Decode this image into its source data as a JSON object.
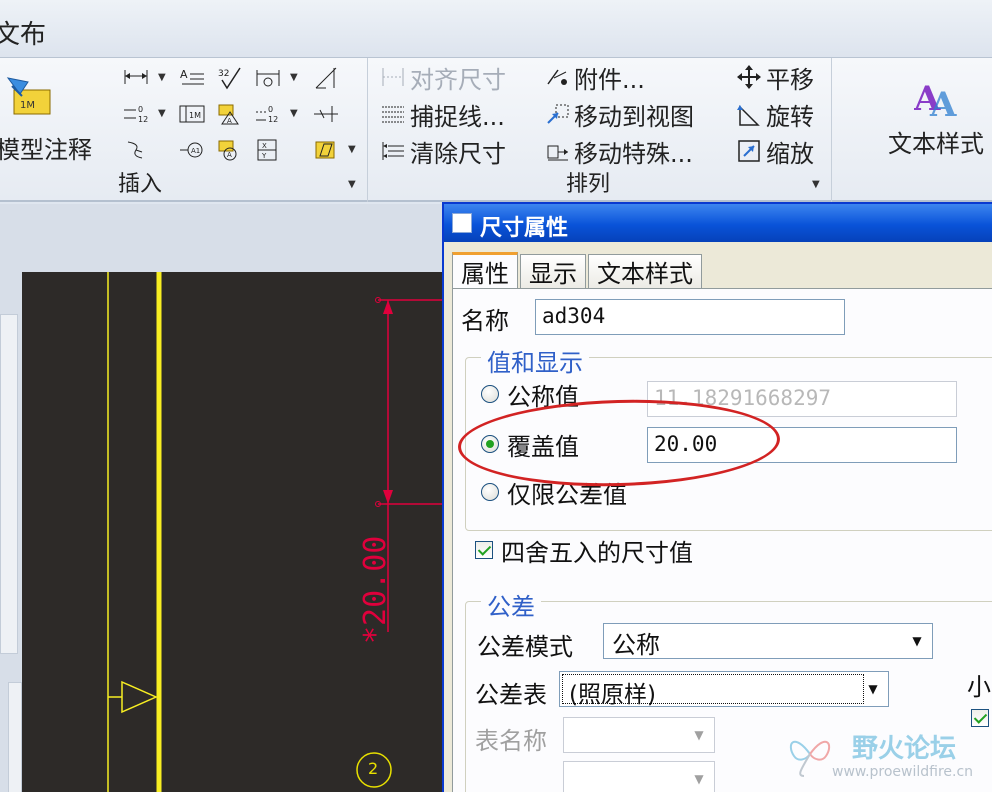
{
  "ribbon": {
    "tab_label": "文布",
    "insert_group": {
      "label": "插入",
      "big_button_label": "模型注释",
      "icons": [
        "linear-dimension-icon",
        "note-icon",
        "surface-finish-icon",
        "ordinate-dimension-icon",
        "reference-dimension-icon",
        "baseline-dimension-icon",
        "table-icon",
        "datum-feature-icon",
        "ordinate-baseline-icon",
        "jog-icon",
        "symbol-icon",
        "balloon-icon",
        "datum-target-icon",
        "geometric-tolerance-icon",
        "flatness-icon"
      ]
    },
    "arrange_group": {
      "label": "排列",
      "commands": [
        {
          "label": "对齐尺寸",
          "icon": "align-dimension-icon",
          "disabled": true
        },
        {
          "label": "附件...",
          "icon": "attachment-icon",
          "disabled": false
        },
        {
          "label": "平移",
          "icon": "move-icon",
          "disabled": false
        },
        {
          "label": "捕捉线...",
          "icon": "snap-line-icon",
          "disabled": false
        },
        {
          "label": "移动到视图",
          "icon": "move-to-view-icon",
          "disabled": false
        },
        {
          "label": "旋转",
          "icon": "rotate-icon",
          "disabled": false
        },
        {
          "label": "清除尺寸",
          "icon": "clean-dimension-icon",
          "disabled": false
        },
        {
          "label": "移动特殊...",
          "icon": "move-special-icon",
          "disabled": false
        },
        {
          "label": "缩放",
          "icon": "scale-icon",
          "disabled": false
        }
      ]
    },
    "text_style_group": {
      "label": "文本样式"
    }
  },
  "drawing": {
    "dimension_text": "*20.00",
    "balloon_number": "2",
    "colors": {
      "background": "#2d2a28",
      "geometry": "#f7ee22",
      "dimension": "#e0003c",
      "balloon": "#e8e000"
    }
  },
  "dialog": {
    "title": "尺寸属性",
    "tabs": [
      {
        "label": "属性",
        "active": true
      },
      {
        "label": "显示",
        "active": false
      },
      {
        "label": "文本样式",
        "active": false
      }
    ],
    "name_label": "名称",
    "name_value": "ad304",
    "value_display": {
      "legend": "值和显示",
      "nominal_label": "公称值",
      "nominal_value": "11.18291668297",
      "override_label": "覆盖值",
      "override_value": "20.00",
      "tolerance_only_label": "仅限公差值",
      "selected": "override",
      "rounded_label": "四舍五入的尺寸值",
      "rounded_checked": true
    },
    "tolerance": {
      "legend": "公差",
      "mode_label": "公差模式",
      "mode_value": "公称",
      "table_label": "公差表",
      "table_value": "(照原样)",
      "table_name_label": "表名称",
      "table_name_value": "",
      "extra_value": "",
      "side_label": "小",
      "side_checked": true
    }
  },
  "watermark": {
    "title": "野火论坛",
    "url": "www.proewildfire.cn"
  },
  "colors": {
    "annotation": "#d22323",
    "titlebar": "#0953d9",
    "legend_text": "#3060c8"
  }
}
